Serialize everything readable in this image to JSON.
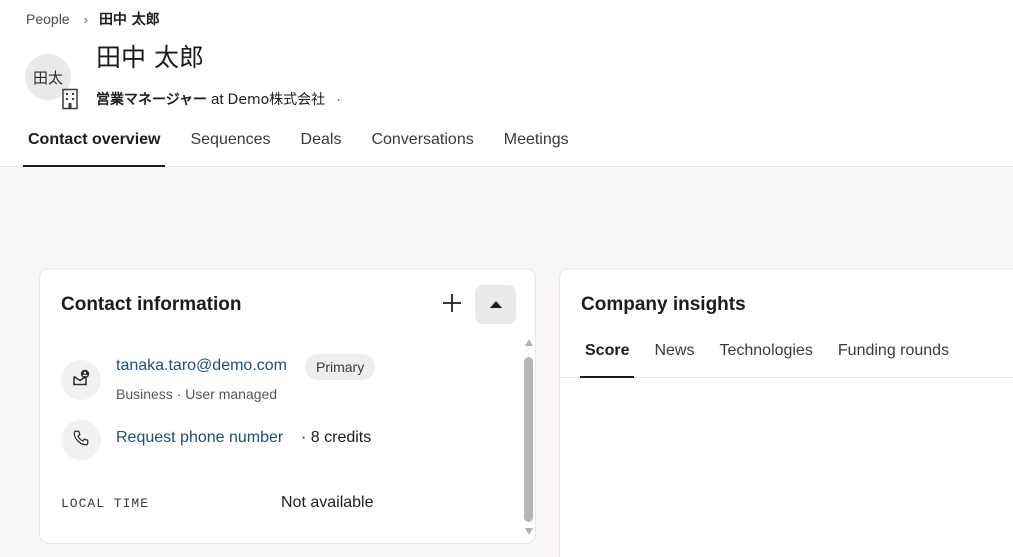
{
  "breadcrumb": {
    "parent": "People",
    "separator": "›",
    "current": "田中 太郎"
  },
  "contact": {
    "avatar_initials": "田太",
    "name": "田中 太郎",
    "job_title": "営業マネージャー",
    "at_word": "at",
    "company": "Demo株式会社",
    "dot": "·"
  },
  "tabs": [
    {
      "label": "Contact overview",
      "active": true
    },
    {
      "label": "Sequences",
      "active": false
    },
    {
      "label": "Deals",
      "active": false
    },
    {
      "label": "Conversations",
      "active": false
    },
    {
      "label": "Meetings",
      "active": false
    }
  ],
  "contact_info": {
    "title": "Contact information",
    "add_icon": "plus-icon",
    "collapse_icon": "caret-up-icon",
    "email": {
      "icon": "email-icon",
      "address": "tanaka.taro@demo.com",
      "badge": "Primary",
      "meta": "Business · User managed"
    },
    "phone": {
      "icon": "phone-icon",
      "link": "Request phone number",
      "credits": "· 8 credits"
    },
    "local_time": {
      "label": "LOCAL TIME",
      "value": "Not available"
    }
  },
  "company_insights": {
    "title": "Company insights",
    "tabs": [
      {
        "label": "Score",
        "active": true
      },
      {
        "label": "News",
        "active": false
      },
      {
        "label": "Technologies",
        "active": false
      },
      {
        "label": "Funding rounds",
        "active": false
      }
    ]
  },
  "colors": {
    "link": "#1f4f78",
    "page_bg": "#f9f6f7",
    "text": "#1d1c1d"
  }
}
